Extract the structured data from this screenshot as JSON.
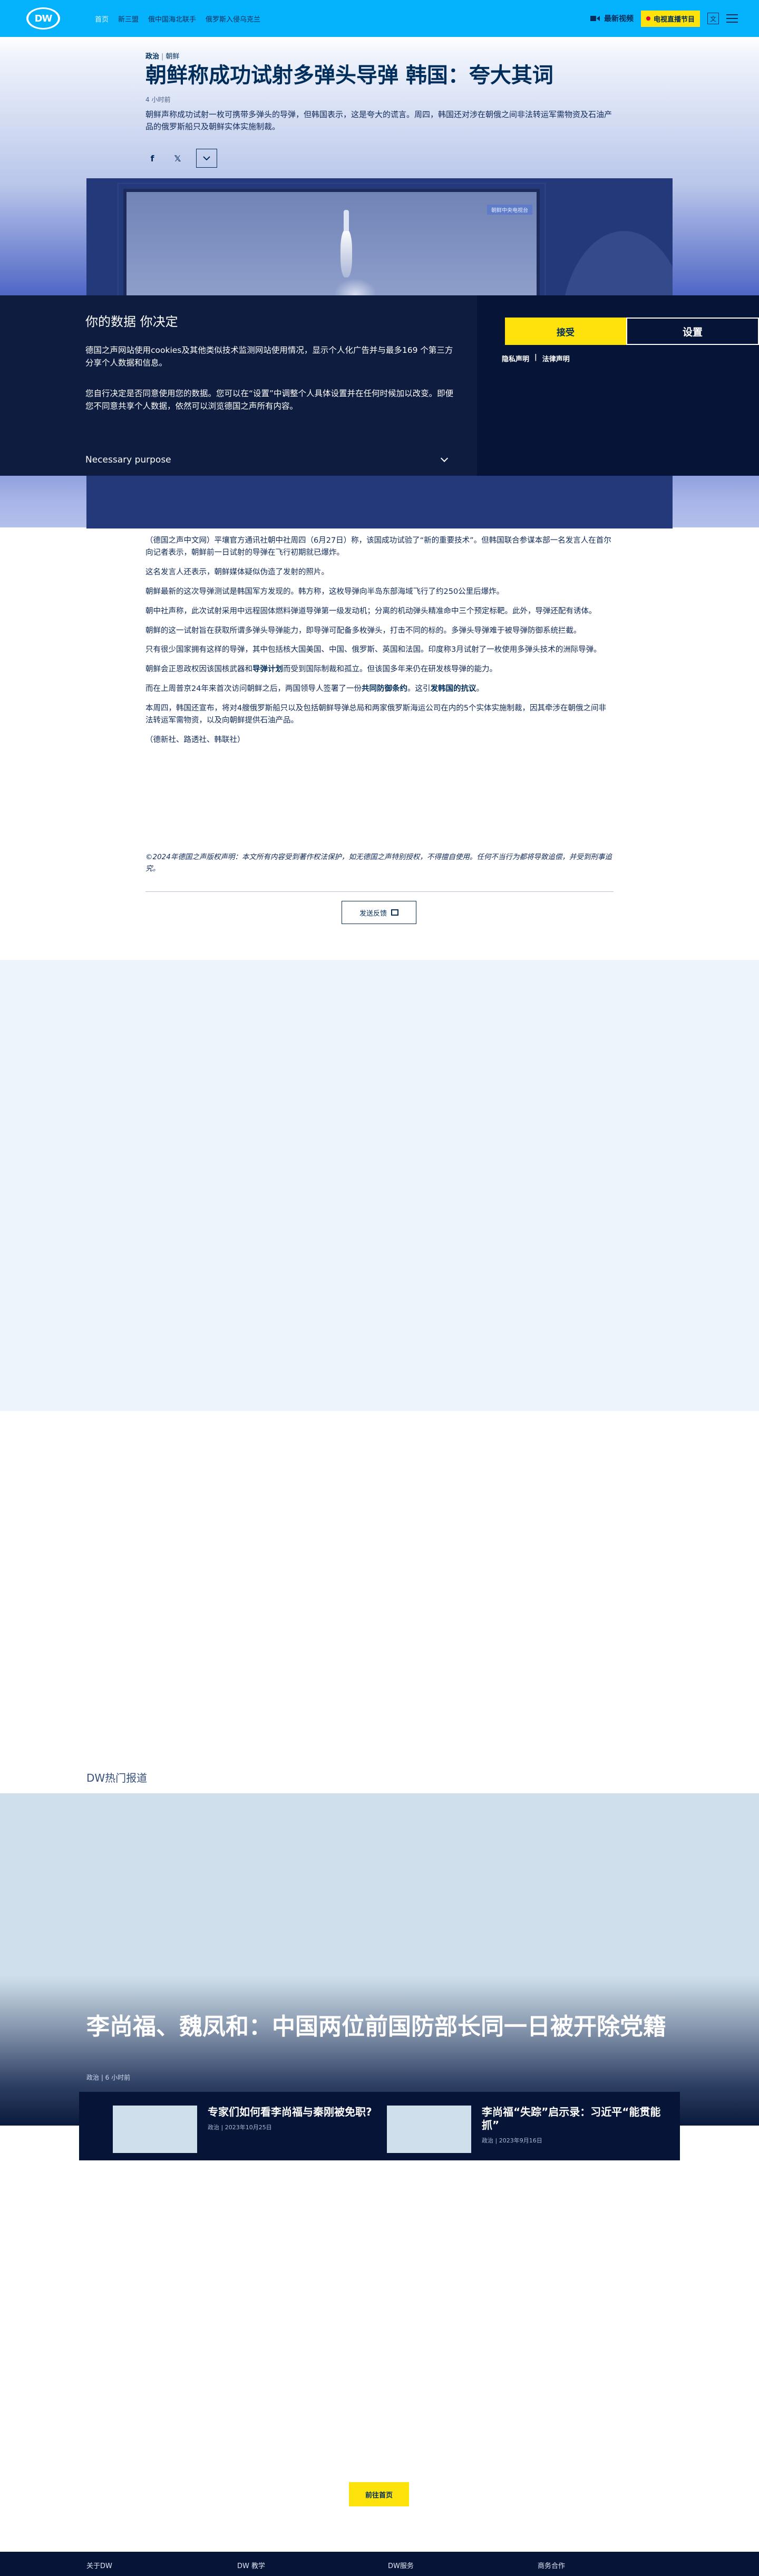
{
  "header": {
    "logo": "DW",
    "nav": [
      "首页",
      "新三盟",
      "俄中国海北联手",
      "俄罗斯入侵乌克兰"
    ],
    "latest_video": "最新视频",
    "live_tv": "电视直播节目",
    "lang": "文"
  },
  "article": {
    "category": "政治",
    "subcategory": "朝鲜",
    "headline": "朝鲜称成功试射多弹头导弹 韩国：夸大其词",
    "time": "4 小时前",
    "teaser": "朝鲜声称成功试射一枚可携带多弹头的导弹，但韩国表示，这是夸大的谎言。周四，韩国还对涉在朝俄之间非法转运军需物资及石油产品的俄罗斯船只及朝鲜实体实施制裁。",
    "hero_badge": "朝鲜中央电视台",
    "paragraphs": [
      "（德国之声中文网）平壤官方通讯社朝中社周四（6月27日）称，该国成功试验了“新的重要技术”。但韩国联合参谋本部一名发言人在首尔向记者表示，朝鲜前一日试射的导弹在飞行初期就已爆炸。",
      "这名发言人还表示，朝鲜媒体疑似伪造了发射的照片。",
      "朝鲜最新的这次导弹测试是韩国军方发现的。韩方称，这枚导弹向半岛东部海域飞行了约250公里后爆炸。",
      "朝中社声称，此次试射采用中远程固体燃料弹道导弹第一级发动机；分离的机动弹头精准命中三个预定标靶。此外，导弹还配有诱体。",
      "朝鲜的这一试射旨在获取所谓多弹头导弹能力，即导弹可配备多枚弹头，打击不同的标的。多弹头导弹难于被导弹防御系统拦截。",
      "只有很少国家拥有这样的导弹，其中包括核大国美国、中国、俄罗斯、英国和法国。印度称3月试射了一枚使用多弹头技术的洲际导弹。"
    ],
    "para7_pre": "朝鲜会正恩政权因该国核武器和",
    "para7_link": "导弹计划",
    "para7_post": "而受到国际制裁和孤立。但该国多年来仍在研发核导弹的能力。",
    "para8_pre": "而在上周普京24年来首次访问朝鲜之后，两国领导人签署了一份",
    "para8_link1": "共同防御条约",
    "para8_mid": "。这引",
    "para8_link2": "发韩国的抗议",
    "para8_post": "。",
    "para9": "本周四，韩国还宣布，将对4艘俄罗斯船只以及包括朝鲜导弹总局和两家俄罗斯海运公司在内的5个实体实施制裁，因其牵涉在朝俄之间非法转运军需物资，以及向朝鲜提供石油产品。",
    "para10": "（德新社、路透社、韩联社）",
    "copyright": "©2024年德国之声版权声明：本文所有内容受到著作权法保护，如无德国之声特别授权，不得擅自使用。任何不当行为都将导致追偿，并受到刑事追究。",
    "feedback": "发送反馈"
  },
  "hot": {
    "section": "DW热门报道",
    "title": "李尚福、魏凤和：中国两位前国防部长同一日被开除党籍",
    "meta": "政治 | 6 小时前",
    "items": [
      {
        "title": "专家们如何看李尚福与秦刚被免职?",
        "meta": "政治 | 2023年10月25日"
      },
      {
        "title": "李尚福“失踪”启示录：习近平“能贯能抓”",
        "meta": "政治 | 2023年9月16日"
      }
    ],
    "more": "前往首页"
  },
  "footer": [
    "关于DW",
    "DW 教学",
    "DW服务",
    "商务合作"
  ],
  "consent": {
    "title": "你的数据 你决定",
    "p1": "德国之声网站使用cookies及其他类似技术监测网站使用情况，显示个人化广告并与最多169 个第三方分享个人数据和信息。",
    "p2": "您自行决定是否同意使用您的数据。您可以在“设置”中调整个人具体设置并在任何时候加以改变。即便您不同意共享个人数据，依然可以浏览德国之声所有内容。",
    "purpose": "Necessary purpose",
    "accept": "接受",
    "settings": "设置",
    "privacy": "隐私声明",
    "legal": "法律声明",
    "links_sep": "|"
  }
}
